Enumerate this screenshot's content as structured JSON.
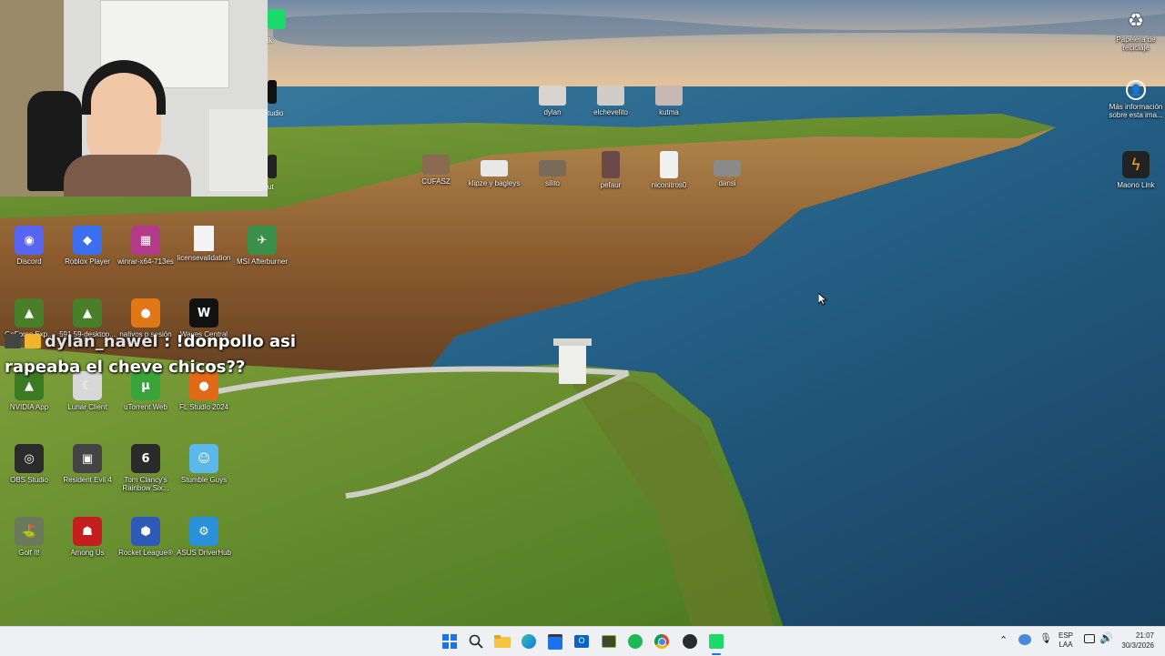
{
  "desktop": {
    "left_column": [
      {
        "label": "Discord",
        "icon": "discord-icon",
        "color": "#5865f2",
        "glyph": "◉"
      },
      {
        "label": "Roblox Player",
        "icon": "roblox-icon",
        "color": "#3b6ff0",
        "glyph": "◆"
      },
      {
        "label": "winrar-x64-713es",
        "icon": "winrar-icon",
        "color": "#b33c8a",
        "glyph": "▦"
      },
      {
        "label": "licensevalidation",
        "icon": "document-icon",
        "color": "#f4f4f4",
        "glyph": ""
      },
      {
        "label": "MSI Afterburner",
        "icon": "msi-afterburner-icon",
        "color": "#3a8f4a",
        "glyph": "✈"
      },
      {
        "label": "GeForce Exp...",
        "icon": "nvidia-icon",
        "color": "#4a7f2a",
        "glyph": "▲"
      },
      {
        "label": "591.59-desktop...",
        "icon": "nvidia-installer-icon",
        "color": "#4a7f2a",
        "glyph": "▲"
      },
      {
        "label": "nativos p sesión",
        "icon": "fl-studio-icon",
        "color": "#e07818",
        "glyph": "●"
      },
      {
        "label": "Waves Central",
        "icon": "waves-icon",
        "color": "#111111",
        "glyph": "W"
      },
      {
        "label": "NVIDIA App",
        "icon": "nvidia-app-icon",
        "color": "#3d7a24",
        "glyph": "▲"
      },
      {
        "label": "Lunar Client",
        "icon": "lunar-client-icon",
        "color": "#d8d8d8",
        "glyph": "☾"
      },
      {
        "label": "uTorrent Web",
        "icon": "utorrent-icon",
        "color": "#3aa43a",
        "glyph": "µ"
      },
      {
        "label": "FL Studio 2024",
        "icon": "fl-studio-2024-icon",
        "color": "#e06a18",
        "glyph": "●"
      },
      {
        "label": "OBS Studio",
        "icon": "obs-icon",
        "color": "#2b2b2b",
        "glyph": "◎"
      },
      {
        "label": "Resident Evil 4",
        "icon": "resident-evil-icon",
        "color": "#444444",
        "glyph": "▣"
      },
      {
        "label": "Tom Clancy's Rainbow Six...",
        "icon": "rainbow-six-icon",
        "color": "#2a2a2a",
        "glyph": "6"
      },
      {
        "label": "Stumble Guys",
        "icon": "stumble-guys-icon",
        "color": "#5bb8e8",
        "glyph": "☺"
      },
      {
        "label": "Golf It!",
        "icon": "golf-it-icon",
        "color": "#6a7a5a",
        "glyph": "⛳"
      },
      {
        "label": "Among Us",
        "icon": "among-us-icon",
        "color": "#c41e1e",
        "glyph": "☗"
      },
      {
        "label": "Rocket League®",
        "icon": "rocket-league-icon",
        "color": "#2f5ab8",
        "glyph": "⬢"
      },
      {
        "label": "ASUS DriverHub",
        "icon": "asus-driverhub-icon",
        "color": "#2a90d8",
        "glyph": "⚙"
      }
    ],
    "top_icons": [
      {
        "label": "dylan",
        "icon": "dylan-photo-icon"
      },
      {
        "label": "elchevelito",
        "icon": "elchevelito-photo-icon"
      },
      {
        "label": "kutma",
        "icon": "kutma-photo-icon"
      },
      {
        "label": "CUFASZ",
        "icon": "cufasz-photo-icon"
      },
      {
        "label": "klipze y bagleys",
        "icon": "klipze-photo-icon"
      },
      {
        "label": "silito",
        "icon": "silito-photo-icon"
      },
      {
        "label": "pefaur",
        "icon": "pefaur-photo-icon"
      },
      {
        "label": "niconitros0",
        "icon": "niconitros-photo-icon"
      },
      {
        "label": "dansi",
        "icon": "dansi-photo-icon"
      }
    ],
    "partial_labels": [
      "lk",
      "tudio",
      "ut"
    ],
    "right_icons": [
      {
        "label": "Papelera de reciclaje",
        "icon": "recycle-bin-icon"
      },
      {
        "label": "Más información sobre esta ima...",
        "icon": "spotlight-info-icon"
      },
      {
        "label": "Maono Link",
        "icon": "maono-link-icon"
      }
    ]
  },
  "chat": {
    "username": "dylan_nawel",
    "separator": ":",
    "message_line1": "!donpollo asi",
    "message_line2": "rapeaba el cheve chicos??"
  },
  "taskbar": {
    "apps": [
      "windows-start-icon",
      "search-icon",
      "file-explorer-icon",
      "edge-icon",
      "store-icon",
      "outlook-icon",
      "game-app-icon",
      "spotify-icon",
      "chrome-icon",
      "obs-taskbar-icon",
      "kick-icon"
    ],
    "tray": {
      "language_top": "ESP",
      "language_bottom": "LAA",
      "time": "21:07",
      "date": "30/3/2026"
    }
  }
}
